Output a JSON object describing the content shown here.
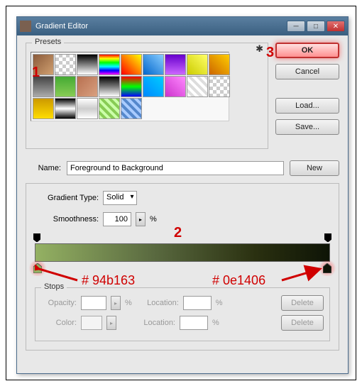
{
  "window": {
    "title": "Gradient Editor",
    "min": "─",
    "max": "□",
    "close": "✕"
  },
  "presets": {
    "label": "Presets",
    "gear": "✱"
  },
  "buttons": {
    "ok": "OK",
    "cancel": "Cancel",
    "load": "Load...",
    "save": "Save...",
    "new": "New",
    "delete": "Delete"
  },
  "name": {
    "label": "Name:",
    "value": "Foreground to Background"
  },
  "gradient": {
    "type_label": "Gradient Type:",
    "type_value": "Solid",
    "smooth_label": "Smoothness:",
    "smooth_value": "100",
    "percent": "%"
  },
  "stops": {
    "label": "Stops",
    "opacity": "Opacity:",
    "color": "Color:",
    "location": "Location:",
    "left_color": "#94b163",
    "right_color": "#0e1406"
  },
  "annotations": {
    "n1": "1",
    "n2": "2",
    "n3": "3",
    "hex_left": "# 94b163",
    "hex_right": "# 0e1406"
  },
  "swatches": [
    "linear-gradient(135deg,#8a5a3a,#d0a070)",
    "repeating-conic-gradient(#ccc 0 25%, #fff 0 50%) 0/10px 10px",
    "linear-gradient(#000,#fff)",
    "linear-gradient(#f00,#ff0,#0f0,#0ff,#00f,#f0f)",
    "linear-gradient(45deg,#f00,#ff0)",
    "linear-gradient(45deg,#06c,#8cf)",
    "linear-gradient(#60c,#c6f)",
    "linear-gradient(45deg,#cc0,#ff6)",
    "linear-gradient(45deg,#c60,#fc0)",
    "linear-gradient(#444,#aaa)",
    "linear-gradient(#4a3,#8c5)",
    "linear-gradient(135deg,#b87050,#d8a080)",
    "linear-gradient(#000,#777,#fff)",
    "linear-gradient(#f00,#0f0,#00f)",
    "linear-gradient(45deg,#08f,#0cf)",
    "linear-gradient(45deg,#c3c,#f8f)",
    "repeating-linear-gradient(45deg,#fff 0 4px,#ddd 4px 8px)",
    "repeating-conic-gradient(#ccc 0 25%, #fff 0 50%) 0/10px 10px",
    "linear-gradient(#c90,#fd0)",
    "linear-gradient(#000,#fff,#000)",
    "linear-gradient(#fff,#ccc,#fff)",
    "repeating-linear-gradient(45deg,#cfa 0 4px,#8c5 4px 8px)",
    "repeating-linear-gradient(45deg,#acf 0 4px,#58c 4px 8px)"
  ]
}
